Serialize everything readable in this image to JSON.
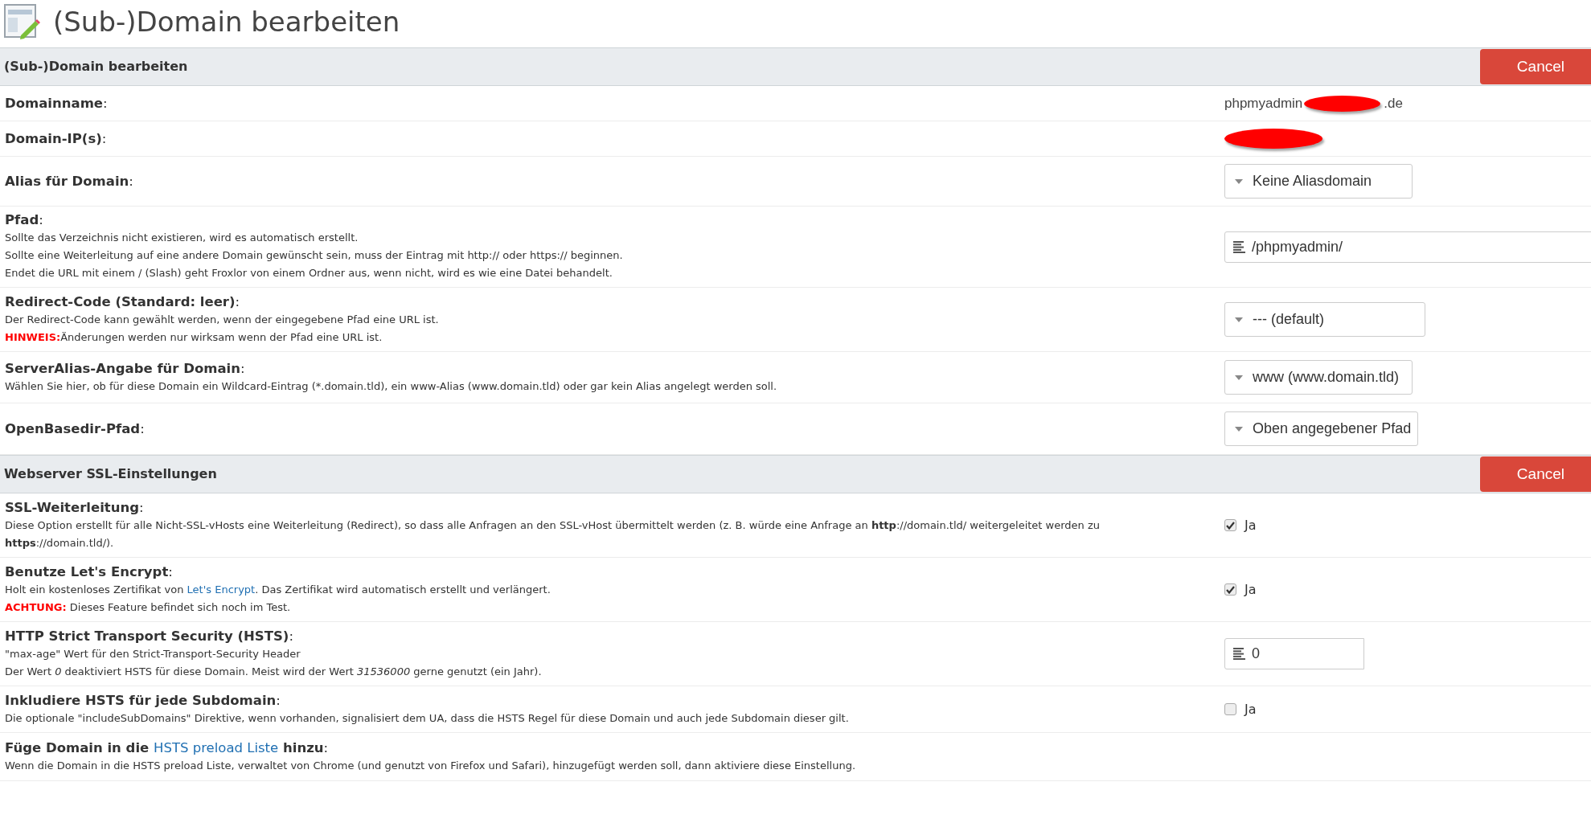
{
  "page_title": "(Sub-)Domain bearbeiten",
  "sections": [
    {
      "title": "(Sub-)Domain bearbeiten",
      "cancel_button": "Cancel",
      "rows": [
        {
          "label": [
            {
              "text": "Domainname",
              "kind": "bold"
            },
            {
              "text": ":",
              "kind": "plain"
            }
          ],
          "field": {
            "kind": "text",
            "value": "phpmyadmin",
            "redacted": true,
            "suffix": ".de"
          }
        },
        {
          "label": [
            {
              "text": "Domain-IP(s)",
              "kind": "bold"
            },
            {
              "text": ":",
              "kind": "plain"
            }
          ],
          "field": {
            "kind": "text",
            "redacted": true
          }
        },
        {
          "label": [
            {
              "text": "Alias für Domain",
              "kind": "bold"
            },
            {
              "text": ":",
              "kind": "plain"
            }
          ],
          "field": {
            "kind": "select",
            "value": "Keine Aliasdomain"
          }
        },
        {
          "label": [
            {
              "text": "Pfad",
              "kind": "bold"
            },
            {
              "text": ":",
              "kind": "plain"
            }
          ],
          "descriptions": [
            [
              {
                "text": "Sollte das Verzeichnis nicht existieren, wird es automatisch erstellt.",
                "kind": "plain"
              }
            ],
            [
              {
                "text": "Sollte eine Weiterleitung auf eine andere Domain gewünscht sein, muss der Eintrag mit http:// oder https:// beginnen.",
                "kind": "plain"
              }
            ],
            [
              {
                "text": "Endet die URL mit einem / (Slash) geht Froxlor von einem Ordner aus, wenn nicht, wird es wie eine Datei behandelt.",
                "kind": "plain"
              }
            ]
          ],
          "field": {
            "kind": "input",
            "value": "/phpmyadmin/",
            "wide": true
          }
        },
        {
          "label": [
            {
              "text": "Redirect-Code (Standard: leer)",
              "kind": "bold"
            },
            {
              "text": ":",
              "kind": "plain"
            }
          ],
          "descriptions": [
            [
              {
                "text": "Der Redirect-Code kann gewählt werden, wenn der eingegebene Pfad eine URL ist.",
                "kind": "plain"
              }
            ],
            [
              {
                "text": "HINWEIS:",
                "kind": "warning"
              },
              {
                "text": "Änderungen werden nur wirksam wenn der Pfad eine URL ist.",
                "kind": "plain"
              }
            ]
          ],
          "field": {
            "kind": "select",
            "value": "--- (default)"
          }
        },
        {
          "label": [
            {
              "text": "ServerAlias-Angabe für Domain",
              "kind": "bold"
            },
            {
              "text": ":",
              "kind": "plain"
            }
          ],
          "descriptions": [
            [
              {
                "text": "Wählen Sie hier, ob für diese Domain ein Wildcard-Eintrag (*.domain.tld), ein www-Alias (www.domain.tld) oder gar kein Alias angelegt werden soll.",
                "kind": "plain"
              }
            ]
          ],
          "field": {
            "kind": "select",
            "value": "www (www.domain.tld)"
          }
        },
        {
          "label": [
            {
              "text": "OpenBasedir-Pfad",
              "kind": "bold"
            },
            {
              "text": ":",
              "kind": "plain"
            }
          ],
          "field": {
            "kind": "select",
            "value": "Oben angegebener Pfad"
          }
        }
      ]
    },
    {
      "title": "Webserver SSL-Einstellungen",
      "cancel_button": "Cancel",
      "rows": [
        {
          "label": [
            {
              "text": "SSL-Weiterleitung",
              "kind": "bold"
            },
            {
              "text": ":",
              "kind": "plain"
            }
          ],
          "descriptions": [
            [
              {
                "text": "Diese Option erstellt für alle Nicht-SSL-vHosts eine Weiterleitung (Redirect), so dass alle Anfragen an den SSL-vHost übermittelt werden (z. B. würde eine Anfrage an ",
                "kind": "plain"
              },
              {
                "text": "http",
                "kind": "bold"
              },
              {
                "text": "://domain.tld/ weitergeleitet werden zu",
                "kind": "plain"
              }
            ],
            [
              {
                "text": "https",
                "kind": "bold"
              },
              {
                "text": "://domain.tld/).",
                "kind": "plain"
              }
            ]
          ],
          "field": {
            "kind": "checkbox",
            "label": "Ja",
            "checked": true
          }
        },
        {
          "label": [
            {
              "text": "Benutze Let's Encrypt",
              "kind": "bold"
            },
            {
              "text": ":",
              "kind": "plain"
            }
          ],
          "descriptions": [
            [
              {
                "text": "Holt ein kostenloses Zertifikat von ",
                "kind": "plain"
              },
              {
                "text": "Let's Encrypt",
                "kind": "link"
              },
              {
                "text": ". Das Zertifikat wird automatisch erstellt und verlängert.",
                "kind": "plain"
              }
            ],
            [
              {
                "text": "ACHTUNG:",
                "kind": "warning"
              },
              {
                "text": " Dieses Feature befindet sich noch im Test.",
                "kind": "plain"
              }
            ]
          ],
          "field": {
            "kind": "checkbox",
            "label": "Ja",
            "checked": true
          }
        },
        {
          "label": [
            {
              "text": "HTTP Strict Transport Security (HSTS)",
              "kind": "bold"
            },
            {
              "text": ":",
              "kind": "plain"
            }
          ],
          "descriptions": [
            [
              {
                "text": "\"max-age\" Wert für den Strict-Transport-Security Header",
                "kind": "plain"
              }
            ],
            [
              {
                "text": "Der Wert ",
                "kind": "plain"
              },
              {
                "text": "0",
                "kind": "italic"
              },
              {
                "text": " deaktiviert HSTS für diese Domain. Meist wird der Wert ",
                "kind": "plain"
              },
              {
                "text": "31536000",
                "kind": "italic"
              },
              {
                "text": " gerne genutzt (ein Jahr).",
                "kind": "plain"
              }
            ]
          ],
          "field": {
            "kind": "input",
            "value": "0",
            "wide": false
          }
        },
        {
          "label": [
            {
              "text": "Inkludiere HSTS für jede Subdomain",
              "kind": "bold"
            },
            {
              "text": ":",
              "kind": "plain"
            }
          ],
          "descriptions": [
            [
              {
                "text": "Die optionale \"includeSubDomains\" Direktive, wenn vorhanden, signalisiert dem UA, dass die HSTS Regel für diese Domain und auch jede Subdomain dieser gilt.",
                "kind": "plain"
              }
            ]
          ],
          "field": {
            "kind": "checkbox",
            "label": "Ja",
            "checked": false
          }
        },
        {
          "label": [
            {
              "text": "Füge Domain in die ",
              "kind": "bold"
            },
            {
              "text": "HSTS preload Liste",
              "kind": "link"
            },
            {
              "text": " hinzu",
              "kind": "bold"
            },
            {
              "text": ":",
              "kind": "plain"
            }
          ],
          "descriptions": [
            [
              {
                "text": "Wenn die Domain in die HSTS preload Liste, verwaltet von Chrome (und genutzt von Firefox und Safari), hinzugefügt werden soll, dann aktiviere diese Einstellung.",
                "kind": "plain"
              }
            ]
          ]
        }
      ]
    }
  ]
}
